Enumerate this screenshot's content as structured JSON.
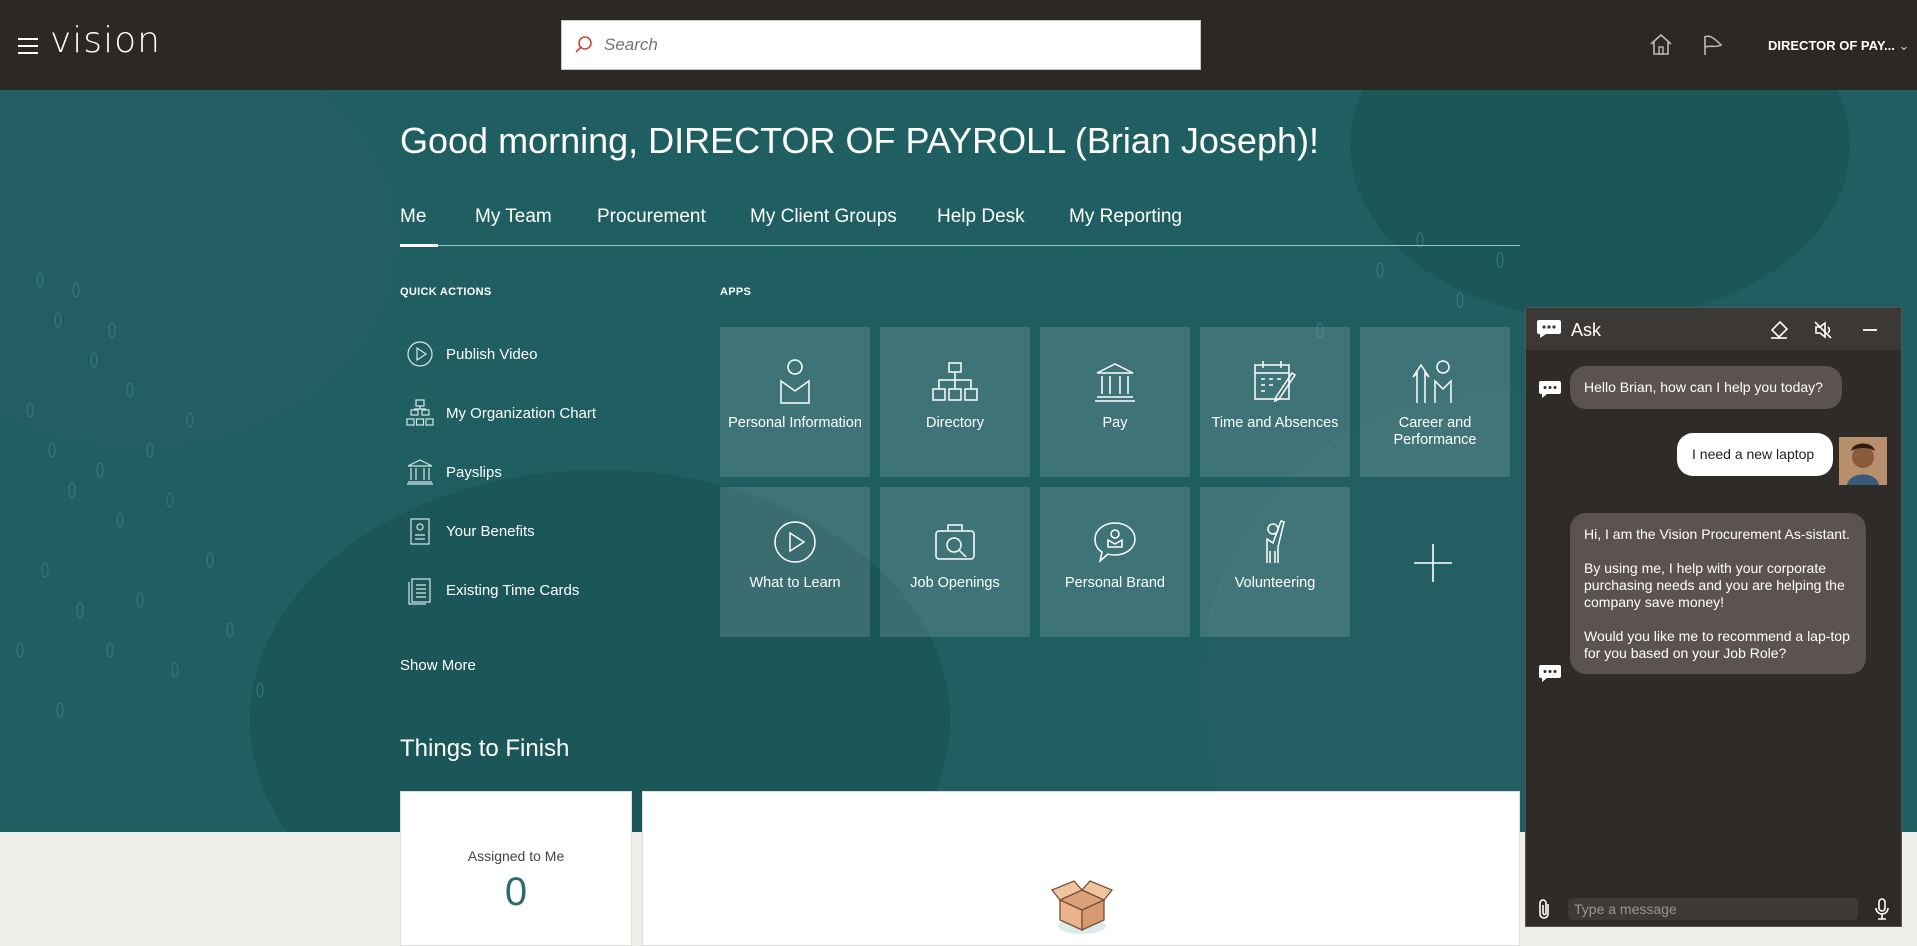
{
  "header": {
    "logo": "vision",
    "search_placeholder": "Search",
    "user_label": "DIRECTOR OF PAY..."
  },
  "greeting": "Good morning, DIRECTOR OF PAYROLL (Brian Joseph)!",
  "tabs": [
    {
      "label": "Me",
      "active": true
    },
    {
      "label": "My Team"
    },
    {
      "label": "Procurement"
    },
    {
      "label": "My Client Groups"
    },
    {
      "label": "Help Desk"
    },
    {
      "label": "My Reporting"
    }
  ],
  "quick_actions": {
    "title": "QUICK ACTIONS",
    "items": [
      {
        "label": "Publish Video",
        "icon": "play-circle-icon"
      },
      {
        "label": "My Organization Chart",
        "icon": "org-chart-icon"
      },
      {
        "label": "Payslips",
        "icon": "bank-icon"
      },
      {
        "label": "Your Benefits",
        "icon": "clipboard-icon"
      },
      {
        "label": "Existing Time Cards",
        "icon": "document-stack-icon"
      }
    ],
    "show_more": "Show More"
  },
  "apps": {
    "title": "APPS",
    "tiles": [
      {
        "label": "Personal Information",
        "icon": "person-icon"
      },
      {
        "label": "Directory",
        "icon": "directory-icon"
      },
      {
        "label": "Pay",
        "icon": "bank-icon"
      },
      {
        "label": "Time and Absences",
        "icon": "calendar-icon"
      },
      {
        "label": "Career and Performance",
        "icon": "career-icon"
      },
      {
        "label": "What to Learn",
        "icon": "play-circle-icon"
      },
      {
        "label": "Job Openings",
        "icon": "briefcase-icon"
      },
      {
        "label": "Personal Brand",
        "icon": "speech-person-icon"
      },
      {
        "label": "Volunteering",
        "icon": "volunteer-icon"
      }
    ],
    "add_icon": "plus-icon"
  },
  "things_to_finish": {
    "title": "Things to Finish",
    "assigned_label": "Assigned to Me",
    "assigned_count": "0"
  },
  "chat": {
    "title": "Ask",
    "messages": [
      {
        "from": "bot",
        "text": "Hello Brian, how can I help you today?"
      },
      {
        "from": "user",
        "text": "I need a new laptop"
      },
      {
        "from": "bot",
        "text": "Hi, I am the Vision Procurement As-sistant.\n\nBy using me, I help with  your corporate purchasing needs and you are helping the company save money!\n\nWould you like me to recommend a lap-top for you based on your Job Role?"
      }
    ],
    "input_placeholder": "Type a message"
  },
  "colors": {
    "header_bg": "#2b2826",
    "hero_bg": "#1f5e61",
    "chat_bg": "#2f2b29",
    "accent_teal": "#2f6a73"
  }
}
